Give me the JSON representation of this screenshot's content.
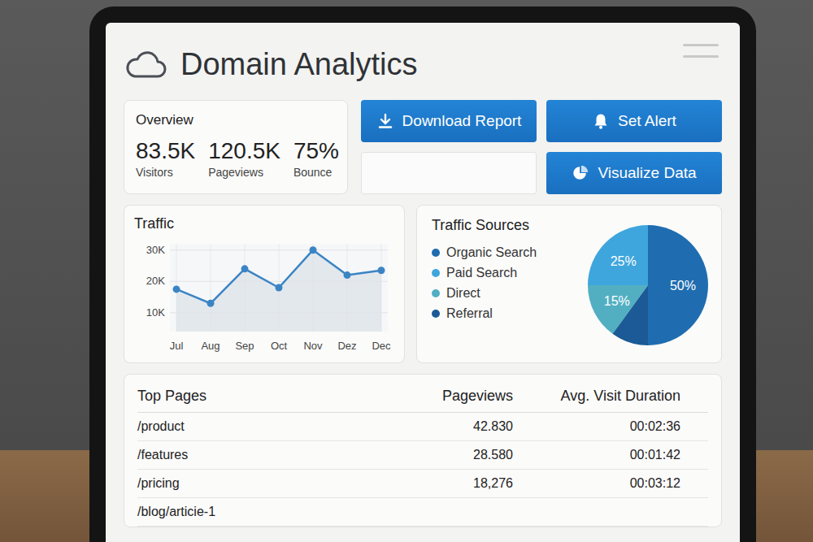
{
  "header": {
    "title": "Domain Analytics"
  },
  "overview": {
    "title": "Overview",
    "stats": [
      {
        "value": "83.5K",
        "label": "Visitors"
      },
      {
        "value": "120.5K",
        "label": "Pageviews"
      },
      {
        "value": "75%",
        "label": "Bounce"
      }
    ]
  },
  "actions": [
    {
      "label": "Download Report"
    },
    {
      "label": "Set Alert"
    },
    {
      "label": "Visualize Data"
    }
  ],
  "traffic": {
    "title": "Traffic",
    "y_ticks": [
      {
        "label": "30K",
        "value": 30000
      },
      {
        "label": "20K",
        "value": 20000
      },
      {
        "label": "10K",
        "value": 10000
      }
    ],
    "x_labels": [
      "Jul",
      "Aug",
      "Sep",
      "Oct",
      "Nov",
      "Dez",
      "Dec"
    ],
    "values": [
      17500,
      13000,
      24000,
      18000,
      30000,
      22000,
      23500
    ]
  },
  "sources": {
    "title": "Traffic Sources",
    "items": [
      {
        "name": "Organic Search",
        "value": 50,
        "share": "50%",
        "color": "#1f6db0"
      },
      {
        "name": "Paid Search",
        "value": 25,
        "share": "25%",
        "color": "#3ea6dc"
      },
      {
        "name": "Direct",
        "value": 15,
        "share": "15%",
        "color": "#52afc2"
      },
      {
        "name": "Referral",
        "value": 10,
        "color": "#1b5a96"
      }
    ]
  },
  "top_pages": {
    "columns": [
      "Top Pages",
      "Pageviews",
      "Avg. Visit Duration"
    ],
    "rows": [
      {
        "page": "/product",
        "pageviews": "42.830",
        "duration": "00:02:36"
      },
      {
        "page": "/features",
        "pageviews": "28.580",
        "duration": "00:01:42"
      },
      {
        "page": "/pricing",
        "pageviews": "18,276",
        "duration": "00:03:12"
      },
      {
        "page": "/blog/articie-1",
        "pageviews": "",
        "duration": ""
      }
    ]
  }
}
